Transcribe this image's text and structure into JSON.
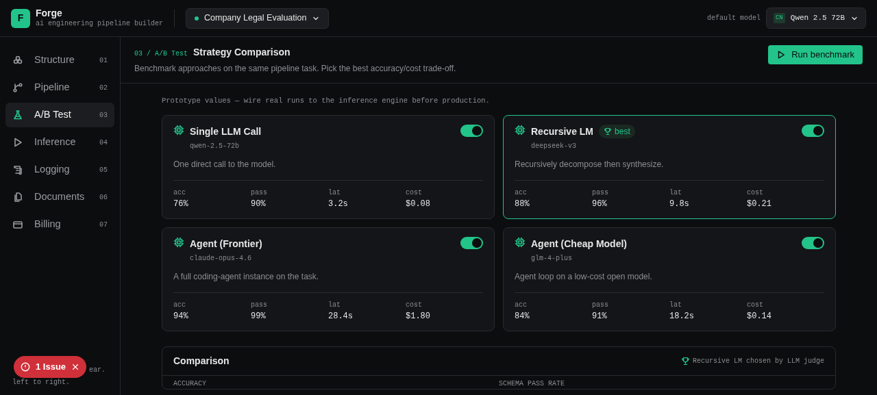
{
  "app": {
    "logo_letter": "F",
    "name": "Forge",
    "tagline": "ai engineering pipeline builder"
  },
  "project": {
    "name": "Company Legal Evaluation"
  },
  "default_model": {
    "label": "default model",
    "tag": "CN",
    "name": "Qwen 2.5 72B"
  },
  "sidebar": {
    "items": [
      {
        "label": "Structure",
        "number": "01",
        "selected": false
      },
      {
        "label": "Pipeline",
        "number": "02",
        "selected": false
      },
      {
        "label": "A/B Test",
        "number": "03",
        "selected": true
      },
      {
        "label": "Inference",
        "number": "04",
        "selected": false
      },
      {
        "label": "Logging",
        "number": "05",
        "selected": false
      },
      {
        "label": "Documents",
        "number": "06",
        "selected": false
      },
      {
        "label": "Billing",
        "number": "07",
        "selected": false
      }
    ],
    "footer_lines": [
      "ear.",
      "left to right."
    ]
  },
  "issues": {
    "label": "1 Issue"
  },
  "page": {
    "crumb": "03 / A/B Test",
    "title": "Strategy Comparison",
    "subtitle": "Benchmark approaches on the same pipeline task. Pick the best accuracy/cost trade-off.",
    "action": "Run benchmark"
  },
  "notice": "Prototype values — wire real runs to the inference engine before production.",
  "strategies": [
    {
      "name": "Single LLM Call",
      "model": "qwen-2.5-72b",
      "description": "One direct call to the model.",
      "on": true,
      "best": false,
      "metrics": [
        {
          "label": "acc",
          "value": "76%"
        },
        {
          "label": "pass",
          "value": "90%"
        },
        {
          "label": "lat",
          "value": "3.2s"
        },
        {
          "label": "cost",
          "value": "$0.08"
        }
      ]
    },
    {
      "name": "Recursive LM",
      "model": "deepseek-v3",
      "description": "Recursively decompose then synthesize.",
      "on": true,
      "best": true,
      "best_label": "best",
      "metrics": [
        {
          "label": "acc",
          "value": "88%"
        },
        {
          "label": "pass",
          "value": "96%"
        },
        {
          "label": "lat",
          "value": "9.8s"
        },
        {
          "label": "cost",
          "value": "$0.21"
        }
      ]
    },
    {
      "name": "Agent (Frontier)",
      "model": "claude-opus-4.6",
      "description": "A full coding-agent instance on the task.",
      "on": true,
      "best": false,
      "metrics": [
        {
          "label": "acc",
          "value": "94%"
        },
        {
          "label": "pass",
          "value": "99%"
        },
        {
          "label": "lat",
          "value": "28.4s"
        },
        {
          "label": "cost",
          "value": "$1.80"
        }
      ]
    },
    {
      "name": "Agent (Cheap Model)",
      "model": "glm-4-plus",
      "description": "Agent loop on a low-cost open model.",
      "on": true,
      "best": false,
      "metrics": [
        {
          "label": "acc",
          "value": "84%"
        },
        {
          "label": "pass",
          "value": "91%"
        },
        {
          "label": "lat",
          "value": "18.2s"
        },
        {
          "label": "cost",
          "value": "$0.14"
        }
      ]
    }
  ],
  "comparison": {
    "title": "Comparison",
    "verdict": "Recursive LM chosen by LLM judge",
    "columns": [
      "ACCURACY",
      "SCHEMA PASS RATE"
    ]
  }
}
